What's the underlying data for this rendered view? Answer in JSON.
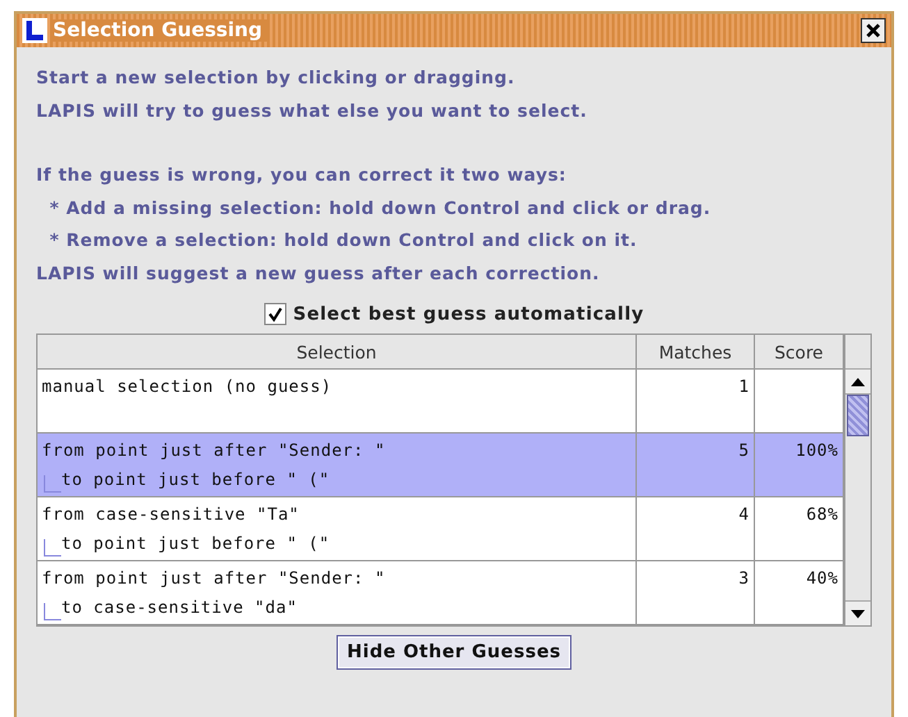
{
  "window": {
    "title": "Selection Guessing"
  },
  "instructions": [
    [
      "Start a new selection by clicking or dragging.",
      "LAPIS will try to guess what else you want to select."
    ],
    [
      "If the guess is wrong, you can correct it two ways:",
      "  * Add a missing selection: hold down Control and click or drag.",
      "  * Remove a selection: hold down Control and click on it.",
      "LAPIS will suggest a new guess after each correction."
    ]
  ],
  "auto_select": {
    "label": "Select best guess automatically",
    "checked": true
  },
  "table": {
    "columns": [
      "Selection",
      "Matches",
      "Score"
    ],
    "rows": [
      {
        "selection": "manual selection (no guess)",
        "matches": "1",
        "selected": false
      },
      {
        "selection": "from point just after \"Sender: \"",
        "child": "to point just before \" (\"",
        "matches": "5",
        "score": "100%",
        "selected": true
      },
      {
        "selection": "from case-sensitive \"Ta\"",
        "child": "to point just before \" (\"",
        "matches": "4",
        "score": "68%",
        "selected": false
      },
      {
        "selection": "from point just after \"Sender: \"",
        "child": "to case-sensitive \"da\"",
        "matches": "3",
        "score": "40%",
        "selected": false
      }
    ]
  },
  "button": {
    "label": "Hide Other Guesses"
  }
}
